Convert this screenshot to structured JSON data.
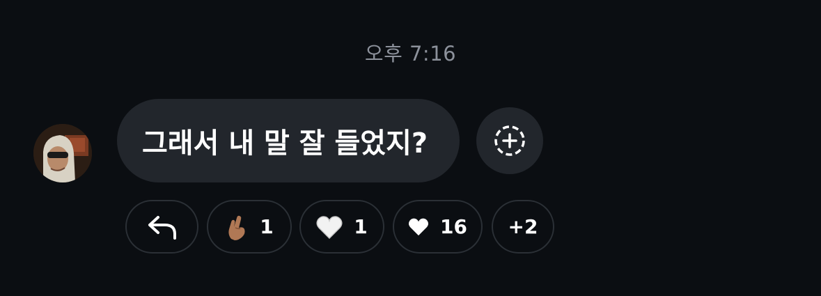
{
  "timestamp": "오후 7:16",
  "message": {
    "text": "그래서 내 말 잘 들었지?",
    "sender_avatar_icon": "user-avatar"
  },
  "add_reaction_icon": "add-reaction-icon",
  "reply_icon": "reply-arrow-icon",
  "reactions": [
    {
      "emoji": "finger-heart-emoji",
      "count": "1"
    },
    {
      "emoji": "white-heart-emoji",
      "count": "1"
    },
    {
      "emoji": "white-heart-solid-emoji",
      "count": "16"
    }
  ],
  "more_reactions": "+2",
  "colors": {
    "background": "#0b0e12",
    "bubble": "#22262c",
    "pill_border": "#2b3036",
    "timestamp": "#8c919b"
  }
}
